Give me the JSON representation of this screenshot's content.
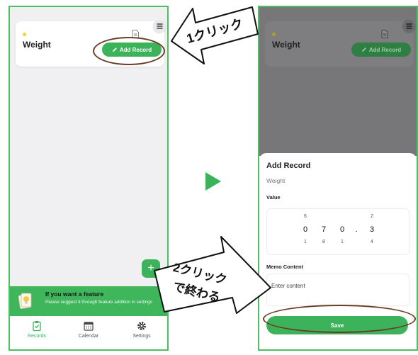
{
  "left": {
    "card": {
      "title": "Weight",
      "add_label": "Add Record"
    },
    "banner": {
      "title": "If you want a feature",
      "text": "Please suggest it through feature addition in settings"
    },
    "tabs": [
      {
        "label": "Records"
      },
      {
        "label": "Calendar"
      },
      {
        "label": "Settings"
      }
    ]
  },
  "right": {
    "card": {
      "title": "Weight",
      "add_label": "Add Record"
    },
    "sheet": {
      "title": "Add Record",
      "subtitle": "Weight",
      "value_label": "Value",
      "picker": [
        {
          "above": "6",
          "value": "0",
          "below": "1"
        },
        {
          "above": "",
          "value": "7",
          "below": "8"
        },
        {
          "above": "",
          "value": "0",
          "below": "1"
        },
        {
          "above": "",
          "value": ".",
          "below": ""
        },
        {
          "above": "2",
          "value": "3",
          "below": "4"
        }
      ],
      "memo_label": "Memo Content",
      "memo_placeholder": "Enter content",
      "save_label": "Save"
    }
  },
  "annotations": {
    "step1": "1クリック",
    "step2_line1": "2クリック",
    "step2_line2": "で終わる"
  },
  "colors": {
    "accent": "#3cb35a",
    "frame": "#4cbf62",
    "annotation_ring": "#6b3c24"
  },
  "icons": [
    "document-icon",
    "menu-icon",
    "pencil-icon",
    "plus-icon",
    "lightbulb-note-icon",
    "clipboard-icon",
    "calendar-icon",
    "gear-icon",
    "play-arrow-icon",
    "callout-arrow-icon"
  ]
}
